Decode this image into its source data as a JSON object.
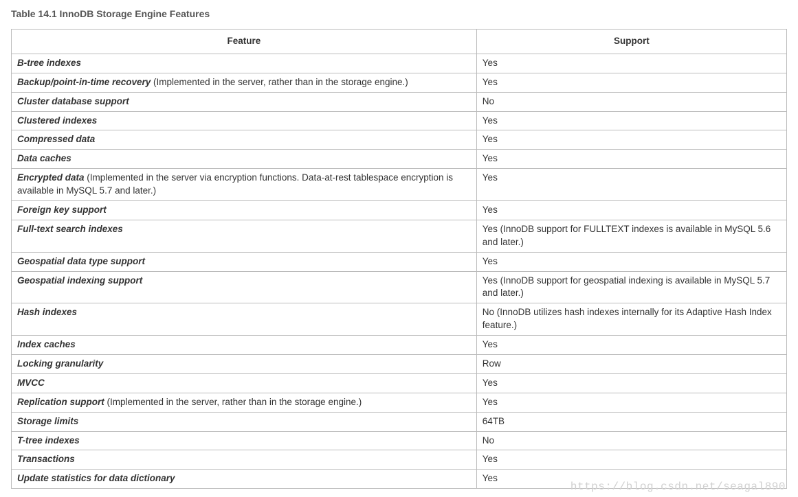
{
  "caption": "Table 14.1 InnoDB Storage Engine Features",
  "headers": {
    "feature": "Feature",
    "support": "Support"
  },
  "rows": [
    {
      "feature": "B-tree indexes",
      "note": "",
      "support": "Yes"
    },
    {
      "feature": "Backup/point-in-time recovery",
      "note": " (Implemented in the server, rather than in the storage engine.)",
      "support": "Yes"
    },
    {
      "feature": "Cluster database support",
      "note": "",
      "support": "No"
    },
    {
      "feature": "Clustered indexes",
      "note": "",
      "support": "Yes"
    },
    {
      "feature": "Compressed data",
      "note": "",
      "support": "Yes"
    },
    {
      "feature": "Data caches",
      "note": "",
      "support": "Yes"
    },
    {
      "feature": "Encrypted data",
      "note": " (Implemented in the server via encryption functions. Data-at-rest tablespace encryption is available in MySQL 5.7 and later.)",
      "support": "Yes"
    },
    {
      "feature": "Foreign key support",
      "note": "",
      "support": "Yes"
    },
    {
      "feature": "Full-text search indexes",
      "note": "",
      "support": "Yes (InnoDB support for FULLTEXT indexes is available in MySQL 5.6 and later.)"
    },
    {
      "feature": "Geospatial data type support",
      "note": "",
      "support": "Yes"
    },
    {
      "feature": "Geospatial indexing support",
      "note": "",
      "support": "Yes (InnoDB support for geospatial indexing is available in MySQL 5.7 and later.)"
    },
    {
      "feature": "Hash indexes",
      "note": "",
      "support": "No (InnoDB utilizes hash indexes internally for its Adaptive Hash Index feature.)"
    },
    {
      "feature": "Index caches",
      "note": "",
      "support": "Yes"
    },
    {
      "feature": "Locking granularity",
      "note": "",
      "support": "Row"
    },
    {
      "feature": "MVCC",
      "note": "",
      "support": "Yes"
    },
    {
      "feature": "Replication support",
      "note": " (Implemented in the server, rather than in the storage engine.)",
      "support": "Yes"
    },
    {
      "feature": "Storage limits",
      "note": "",
      "support": "64TB"
    },
    {
      "feature": "T-tree indexes",
      "note": "",
      "support": "No"
    },
    {
      "feature": "Transactions",
      "note": "",
      "support": "Yes"
    },
    {
      "feature": "Update statistics for data dictionary",
      "note": "",
      "support": "Yes"
    }
  ],
  "watermark": "https://blog.csdn.net/seagal890"
}
